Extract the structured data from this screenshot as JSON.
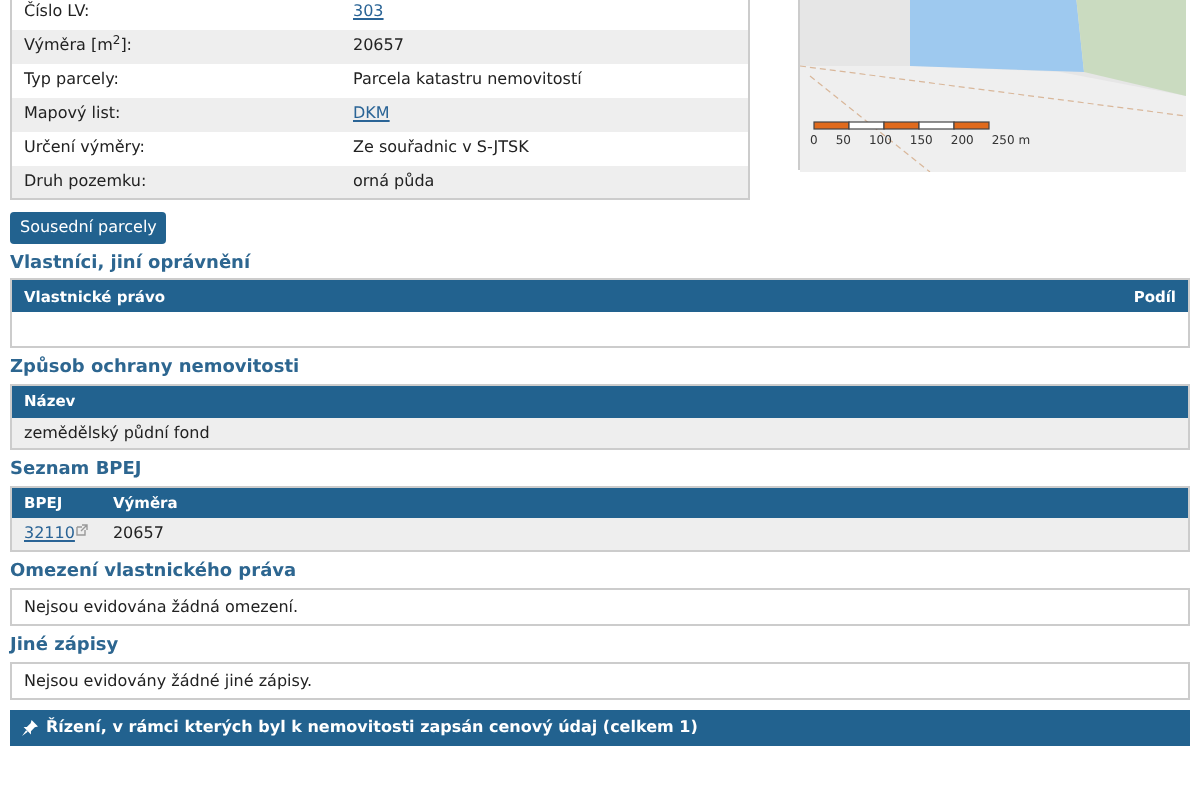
{
  "parcel_info": {
    "rows": [
      {
        "label": "Číslo LV:",
        "value": "303",
        "link": true
      },
      {
        "label": "Výměra [m$^{2}$]:",
        "value": "20657",
        "link": false
      },
      {
        "label": "Typ parcely:",
        "value": "Parcela katastru nemovitostí",
        "link": false
      },
      {
        "label": "Mapový list:",
        "value": "DKM",
        "link": true
      },
      {
        "label": "Určení výměry:",
        "value": "Ze souřadnic v S-JTSK",
        "link": false
      },
      {
        "label": "Druh pozemku:",
        "value": "orná půda",
        "link": false
      }
    ]
  },
  "map": {
    "scale_labels": [
      "0",
      "50",
      "100",
      "150",
      "200",
      "250 m"
    ]
  },
  "neighbors_button": "Sousední parcely",
  "sections": [
    {
      "kind": "table",
      "title": "Vlastníci, jiní oprávnění",
      "columns": [
        "Vlastnické právo",
        "Podíl"
      ]
    },
    {
      "kind": "table",
      "title": "Způsob ochrany nemovitosti",
      "columns": [
        "Název"
      ],
      "rows": [
        [
          {
            "text": "zemědělský půdní fond",
            "link": false
          }
        ]
      ]
    },
    {
      "kind": "table",
      "title": "Seznam BPEJ",
      "columns": [
        "BPEJ",
        "Výměra"
      ],
      "rows": [
        [
          {
            "text": "32110",
            "link": true
          },
          {
            "text": "20657",
            "link": false
          }
        ]
      ]
    },
    {
      "kind": "text",
      "title": "Omezení vlastnického práva",
      "text": "Nejsou evidována žádná omezení."
    },
    {
      "kind": "text",
      "title": "Jiné zápisy",
      "text": "Nejsou evidovány žádné jiné zápisy."
    },
    {
      "kind": "banner",
      "text": "Řízení, v rámci kterých byl k nemovitosti zapsán cenový údaj (celkem 1)"
    }
  ]
}
